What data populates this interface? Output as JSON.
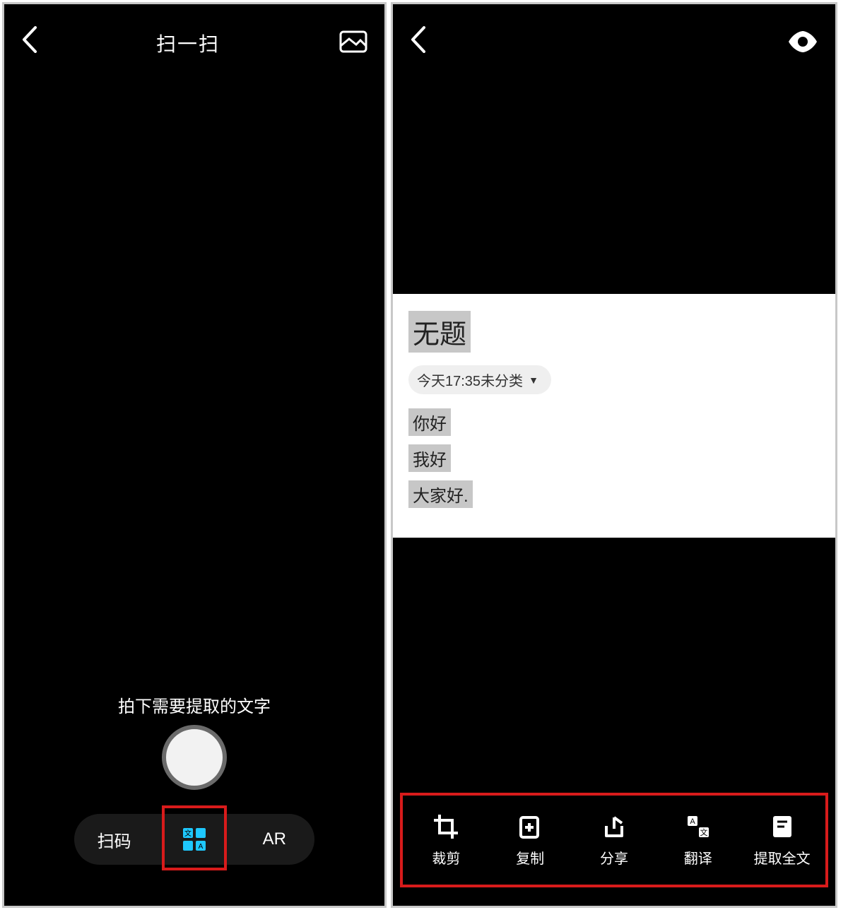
{
  "left": {
    "title": "扫一扫",
    "hint": "拍下需要提取的文字",
    "modes": {
      "scan": "扫码",
      "ar": "AR"
    }
  },
  "right": {
    "note": {
      "title": "无题",
      "timestamp": "今天17:35",
      "category": "未分类",
      "lines": [
        "你好",
        "我好",
        "大家好."
      ]
    },
    "toolbar": {
      "crop": "裁剪",
      "copy": "复制",
      "share": "分享",
      "translate": "翻译",
      "extract": "提取全文"
    }
  }
}
